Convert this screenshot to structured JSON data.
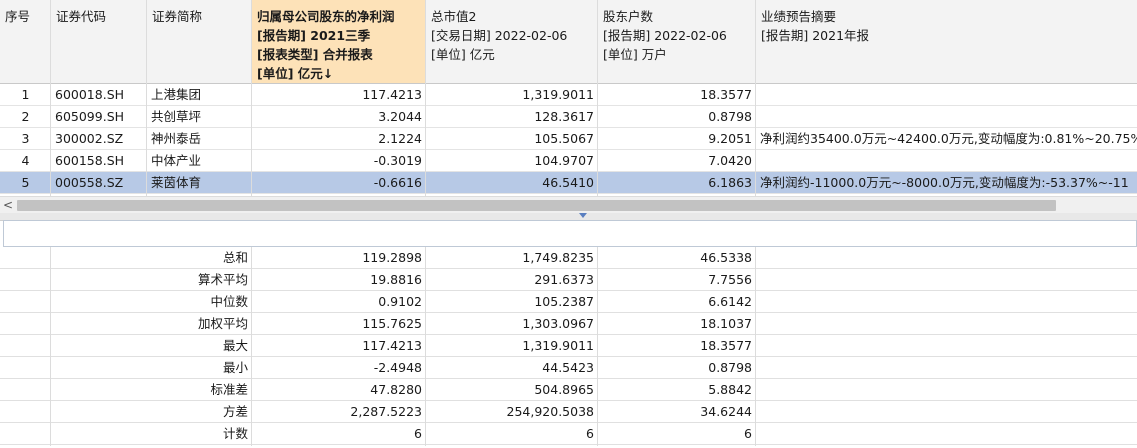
{
  "header": {
    "seq": "序号",
    "code": "证券代码",
    "name": "证券简称",
    "profit_lines": [
      "归属母公司股东的净利润",
      "[报告期] 2021三季",
      "[报表类型] 合并报表",
      "[单位] 亿元↓"
    ],
    "mcap_lines": [
      "总市值2",
      "[交易日期] 2022-02-06",
      "[单位] 亿元"
    ],
    "holders_lines": [
      "股东户数",
      "[报告期] 2022-02-06",
      "[单位] 万户"
    ],
    "forecast_lines": [
      "业绩预告摘要",
      "[报告期] 2021年报"
    ]
  },
  "rows": [
    {
      "seq": "1",
      "code": "600018.SH",
      "name": "上港集团",
      "profit": "117.4213",
      "mcap": "1,319.9011",
      "holders": "18.3577",
      "forecast": ""
    },
    {
      "seq": "2",
      "code": "605099.SH",
      "name": "共创草坪",
      "profit": "3.2044",
      "mcap": "128.3617",
      "holders": "0.8798",
      "forecast": ""
    },
    {
      "seq": "3",
      "code": "300002.SZ",
      "name": "神州泰岳",
      "profit": "2.1224",
      "mcap": "105.5067",
      "holders": "9.2051",
      "forecast": "净利润约35400.0万元~42400.0万元,变动幅度为:0.81%~20.75%"
    },
    {
      "seq": "4",
      "code": "600158.SH",
      "name": "中体产业",
      "profit": "-0.3019",
      "mcap": "104.9707",
      "holders": "7.0420",
      "forecast": ""
    },
    {
      "seq": "5",
      "code": "000558.SZ",
      "name": "莱茵体育",
      "profit": "-0.6616",
      "mcap": "46.5410",
      "holders": "6.1863",
      "forecast": "净利润约-11000.0万元~-8000.0万元,变动幅度为:-53.37%~-11"
    }
  ],
  "scroll_left_arrow": "<",
  "summary": [
    {
      "label": "总和",
      "profit": "119.2898",
      "mcap": "1,749.8235",
      "holders": "46.5338"
    },
    {
      "label": "算术平均",
      "profit": "19.8816",
      "mcap": "291.6373",
      "holders": "7.7556"
    },
    {
      "label": "中位数",
      "profit": "0.9102",
      "mcap": "105.2387",
      "holders": "6.6142"
    },
    {
      "label": "加权平均",
      "profit": "115.7625",
      "mcap": "1,303.0967",
      "holders": "18.1037"
    },
    {
      "label": "最大",
      "profit": "117.4213",
      "mcap": "1,319.9011",
      "holders": "18.3577"
    },
    {
      "label": "最小",
      "profit": "-2.4948",
      "mcap": "44.5423",
      "holders": "0.8798"
    },
    {
      "label": "标准差",
      "profit": "47.8280",
      "mcap": "504.8965",
      "holders": "5.8842"
    },
    {
      "label": "方差",
      "profit": "2,287.5223",
      "mcap": "254,920.5038",
      "holders": "34.6244"
    },
    {
      "label": "计数",
      "profit": "6",
      "mcap": "6",
      "holders": "6"
    }
  ]
}
